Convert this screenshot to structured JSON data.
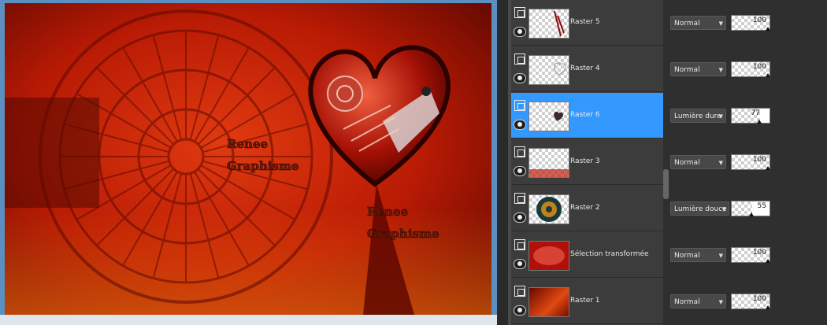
{
  "canvas": {
    "watermark_lines": [
      "Renee",
      "Graphisme"
    ]
  },
  "layers": [
    {
      "name": "Raster 5",
      "blend": "Normal",
      "opacity": 100,
      "selected": false
    },
    {
      "name": "Raster 4",
      "blend": "Normal",
      "opacity": 100,
      "selected": false
    },
    {
      "name": "Raster 6",
      "blend": "Lumière dure",
      "opacity": 77,
      "selected": true
    },
    {
      "name": "Raster 3",
      "blend": "Normal",
      "opacity": 100,
      "selected": false
    },
    {
      "name": "Raster 2",
      "blend": "Lumière douce",
      "opacity": 55,
      "selected": false
    },
    {
      "name": "Sélection transformée",
      "blend": "Normal",
      "opacity": 100,
      "selected": false
    },
    {
      "name": "Raster 1",
      "blend": "Normal",
      "opacity": 100,
      "selected": false
    }
  ],
  "colors": {
    "selection": "#3399ff",
    "panel": "#3c3c3c",
    "canvas_red": "#b91a05"
  }
}
